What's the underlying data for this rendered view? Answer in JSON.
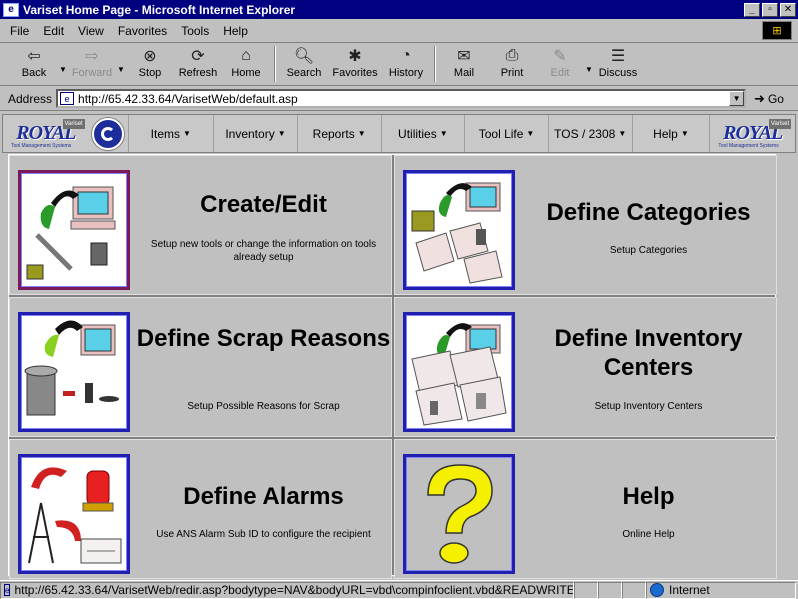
{
  "window": {
    "title": "Variset Home Page - Microsoft Internet Explorer",
    "controls": [
      "_",
      "▫",
      "✕"
    ]
  },
  "menu": [
    "File",
    "Edit",
    "View",
    "Favorites",
    "Tools",
    "Help"
  ],
  "toolbar": {
    "back": "Back",
    "forward": "Forward",
    "stop": "Stop",
    "refresh": "Refresh",
    "home": "Home",
    "search": "Search",
    "favorites": "Favorites",
    "history": "History",
    "mail": "Mail",
    "print": "Print",
    "edit": "Edit",
    "discuss": "Discuss"
  },
  "address": {
    "label": "Address",
    "url": "http://65.42.33.64/VarisetWeb/default.asp",
    "go": "Go"
  },
  "brand": {
    "logo_text": "ROYAL",
    "logo_sub": "Tool Management Systems",
    "badge": "Variset"
  },
  "nav": {
    "items": [
      "Items",
      "Inventory",
      "Reports",
      "Utilities",
      "Tool Life",
      "TOS / 2308",
      "Help"
    ]
  },
  "tiles": [
    {
      "title": "Create/Edit",
      "desc": "Setup new tools or change the information on tools already setup"
    },
    {
      "title": "Define Categories",
      "desc": "Setup Categories"
    },
    {
      "title": "Define Scrap Reasons",
      "desc": "Setup Possible Reasons for Scrap"
    },
    {
      "title": "Define Inventory Centers",
      "desc": "Setup Inventory Centers"
    },
    {
      "title": "Define Alarms",
      "desc": "Use ANS Alarm Sub ID to configure the recipient"
    },
    {
      "title": "Help",
      "desc": "Online Help"
    }
  ],
  "status": {
    "url": "http://65.42.33.64/VarisetWeb/redir.asp?bodytype=NAV&bodyURL=vbd\\compinfoclient.vbd&READWRITE",
    "zone": "Internet"
  },
  "colors": {
    "titlebar": "#000080",
    "brand_blue": "#1d2d9a",
    "tile_frame": "#2020b0",
    "tile_frame_first": "#7a1a5a"
  }
}
